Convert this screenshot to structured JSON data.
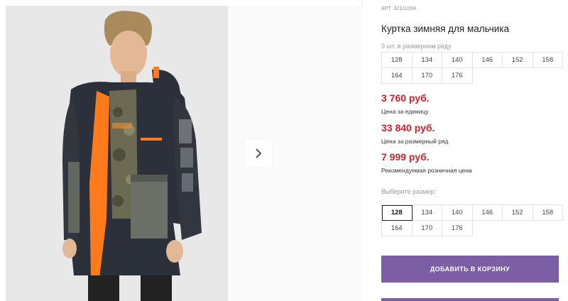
{
  "product": {
    "article": "АРТ. 32111004",
    "title": "Куртка зимняя для мальчика",
    "size_row_note": "9 шт. в размерном ряду",
    "size_row": [
      "128",
      "134",
      "140",
      "146",
      "152",
      "158",
      "164",
      "170",
      "176"
    ]
  },
  "prices": [
    {
      "value": "3 760 руб.",
      "label": "Цена за единицу"
    },
    {
      "value": "33 840 руб.",
      "label": "Цена за размерный ряд"
    },
    {
      "value": "7 999 руб.",
      "label": "Рекомендуемая розничная цена"
    }
  ],
  "size_select": {
    "label": "Выберите размер:",
    "options": [
      "128",
      "134",
      "140",
      "146",
      "152",
      "158",
      "164",
      "170",
      "176"
    ],
    "selected": "128"
  },
  "cart": {
    "add_label": "ДОБАВИТЬ В КОРЗИНУ"
  },
  "colors": {
    "price": "#d6202b",
    "button": "#7b5ea3",
    "jacket": "#2b303a",
    "accent": "#ff7a1a"
  },
  "icons": {
    "next": "chevron-right-icon"
  }
}
